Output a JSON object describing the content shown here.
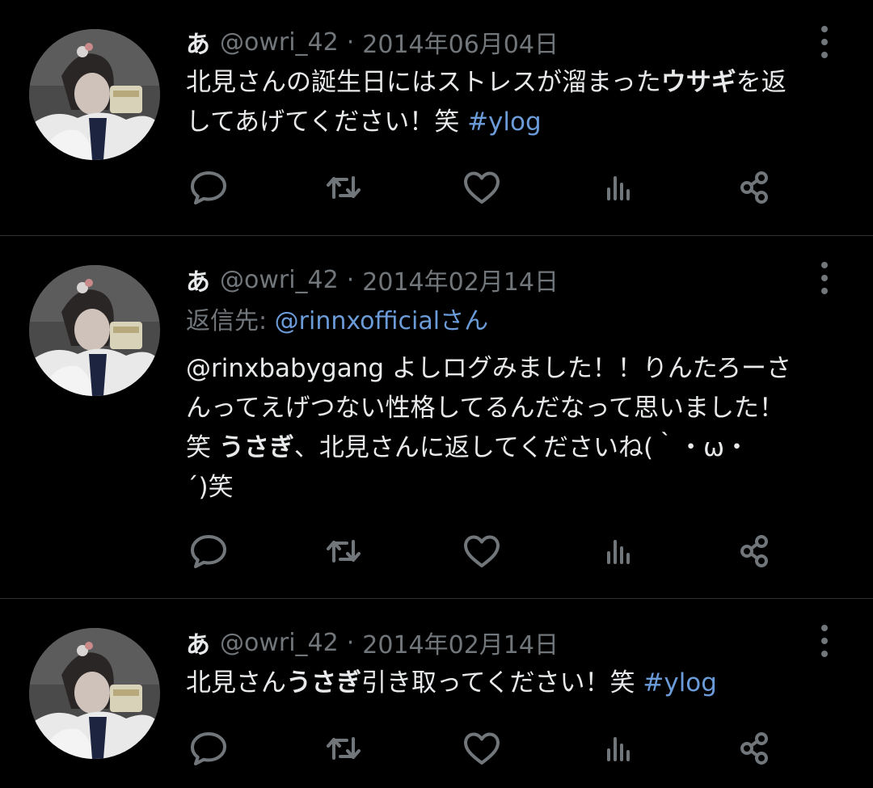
{
  "tweets": [
    {
      "name": "あ",
      "handle": "@owri_42",
      "sep": "·",
      "date": "2014年06月04日",
      "lines": [
        [
          {
            "t": "北見さんの誕生日にはストレスが溜まった"
          },
          {
            "t": "ウサギ",
            "style": "bold"
          },
          {
            "t": "を返"
          }
        ],
        [
          {
            "t": "してあげてください！笑 "
          },
          {
            "t": "#ylog",
            "style": "link"
          }
        ]
      ]
    },
    {
      "name": "あ",
      "handle": "@owri_42",
      "sep": "·",
      "date": "2014年02月14日",
      "reply_label": "返信先: ",
      "reply_to": "@rinnxofficialさん",
      "lines": [
        [
          {
            "t": "@rinxbabygang よしログみました！！りんたろーさ"
          }
        ],
        [
          {
            "t": "んってえげつない性格してるんだなって思いました！"
          }
        ],
        [
          {
            "t": "笑 "
          },
          {
            "t": "うさぎ",
            "style": "bold"
          },
          {
            "t": "、北見さんに返してくださいね(｀・ω・"
          }
        ],
        [
          {
            "t": "´)笑"
          }
        ]
      ]
    },
    {
      "name": "あ",
      "handle": "@owri_42",
      "sep": "·",
      "date": "2014年02月14日",
      "lines": [
        [
          {
            "t": "北見さん"
          },
          {
            "t": "うさぎ",
            "style": "bold"
          },
          {
            "t": "引き取ってください！笑 "
          },
          {
            "t": "#ylog",
            "style": "link"
          }
        ]
      ]
    }
  ],
  "icons": {
    "reply": "reply-icon",
    "retweet": "retweet-icon",
    "like": "heart-icon",
    "views": "views-icon",
    "share": "share-icon",
    "more": "more-vertical-icon"
  },
  "colors": {
    "background": "#000000",
    "text": "#e7e9ea",
    "secondary": "#71767b",
    "link": "#6b9bd8",
    "divider": "#2f3336"
  }
}
